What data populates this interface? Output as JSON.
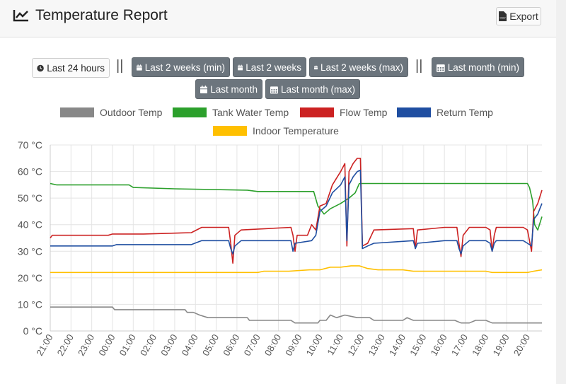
{
  "header": {
    "title": "Temperature Report",
    "export_label": "Export",
    "export_icon": "csv-file-icon"
  },
  "range_buttons": {
    "last_24h": "Last 24 hours",
    "separator": "||",
    "last_2w_min": "Last 2 weeks (min)",
    "last_2w": "Last 2 weeks",
    "last_2w_max": "Last 2 weeks (max)",
    "last_month_min": "Last month (min)",
    "last_month": "Last month",
    "last_month_max": "Last month (max)"
  },
  "chart_data": {
    "type": "line",
    "x_label_times": [
      "21:00",
      "22:00",
      "23:00",
      "00:00",
      "01:00",
      "02:00",
      "03:00",
      "04:00",
      "05:00",
      "06:00",
      "07:00",
      "08:00",
      "09:00",
      "10:00",
      "11:00",
      "12:00",
      "13:00",
      "14:00",
      "15:00",
      "16:00",
      "17:00",
      "18:00",
      "19:00",
      "20:00"
    ],
    "x_range_hours": [
      0,
      23.7
    ],
    "y_ticks": [
      "0 °C",
      "10 °C",
      "20 °C",
      "30 °C",
      "40 °C",
      "50 °C",
      "60 °C",
      "70 °C"
    ],
    "ylim": [
      0,
      70
    ],
    "grid": true,
    "legend_position": "top",
    "series": [
      {
        "name": "Outdoor Temp",
        "color": "#888888",
        "points": [
          [
            0,
            9
          ],
          [
            3.0,
            9
          ],
          [
            3.1,
            8
          ],
          [
            6.5,
            8
          ],
          [
            6.6,
            7
          ],
          [
            6.9,
            7
          ],
          [
            7.2,
            6
          ],
          [
            7.6,
            5
          ],
          [
            8.4,
            5
          ],
          [
            9.5,
            5
          ],
          [
            9.6,
            4
          ],
          [
            11.6,
            4
          ],
          [
            11.8,
            3
          ],
          [
            12.9,
            3
          ],
          [
            13.0,
            4
          ],
          [
            13.3,
            4
          ],
          [
            13.5,
            6
          ],
          [
            13.8,
            5
          ],
          [
            14.2,
            6
          ],
          [
            14.8,
            5
          ],
          [
            15.4,
            5
          ],
          [
            15.6,
            4
          ],
          [
            16.5,
            4
          ],
          [
            17.0,
            4
          ],
          [
            17.2,
            5
          ],
          [
            17.5,
            4
          ],
          [
            18.0,
            4
          ],
          [
            18.5,
            4
          ],
          [
            19.5,
            4
          ],
          [
            19.8,
            3
          ],
          [
            20.2,
            3
          ],
          [
            20.5,
            4
          ],
          [
            21.0,
            4
          ],
          [
            21.3,
            3
          ],
          [
            22.0,
            3
          ],
          [
            23.7,
            3
          ]
        ]
      },
      {
        "name": "Tank Water Temp",
        "color": "#2ca02c",
        "points": [
          [
            0,
            55.5
          ],
          [
            0.3,
            55
          ],
          [
            3.8,
            55
          ],
          [
            4.0,
            54
          ],
          [
            6.0,
            53.5
          ],
          [
            9.5,
            53
          ],
          [
            10.0,
            52.5
          ],
          [
            12.5,
            52.5
          ],
          [
            12.7,
            52.5
          ],
          [
            12.9,
            47
          ],
          [
            13.2,
            44
          ],
          [
            13.5,
            46
          ],
          [
            14.0,
            48
          ],
          [
            14.4,
            50
          ],
          [
            14.7,
            52
          ],
          [
            14.9,
            55.5
          ],
          [
            23.0,
            55.5
          ],
          [
            23.1,
            54
          ],
          [
            23.25,
            49
          ],
          [
            23.35,
            40
          ],
          [
            23.5,
            38
          ],
          [
            23.7,
            43
          ]
        ]
      },
      {
        "name": "Flow Temp",
        "color": "#cc2222",
        "points": [
          [
            0,
            35
          ],
          [
            0.1,
            36
          ],
          [
            2.8,
            36
          ],
          [
            3.0,
            36.5
          ],
          [
            4.5,
            36.5
          ],
          [
            6.8,
            37
          ],
          [
            7.3,
            39
          ],
          [
            8.6,
            39
          ],
          [
            8.7,
            33
          ],
          [
            8.8,
            25.5
          ],
          [
            8.9,
            36
          ],
          [
            9.2,
            38
          ],
          [
            11.6,
            39
          ],
          [
            11.7,
            36
          ],
          [
            11.8,
            30
          ],
          [
            11.9,
            36
          ],
          [
            12.4,
            36
          ],
          [
            12.6,
            40
          ],
          [
            12.8,
            38
          ],
          [
            13.0,
            47
          ],
          [
            13.3,
            48
          ],
          [
            13.6,
            55
          ],
          [
            14.0,
            60
          ],
          [
            14.2,
            63
          ],
          [
            14.3,
            32
          ],
          [
            14.4,
            60
          ],
          [
            14.6,
            63
          ],
          [
            14.8,
            65
          ],
          [
            14.95,
            65
          ],
          [
            15.05,
            32
          ],
          [
            15.3,
            33
          ],
          [
            15.6,
            38
          ],
          [
            17.5,
            38.5
          ],
          [
            17.6,
            31
          ],
          [
            17.7,
            38
          ],
          [
            19.0,
            39
          ],
          [
            19.6,
            39
          ],
          [
            19.7,
            33
          ],
          [
            19.8,
            28
          ],
          [
            19.9,
            36
          ],
          [
            20.2,
            39
          ],
          [
            21.0,
            39
          ],
          [
            21.2,
            38
          ],
          [
            21.3,
            30
          ],
          [
            21.4,
            36
          ],
          [
            21.5,
            39
          ],
          [
            22.8,
            39
          ],
          [
            23.0,
            38
          ],
          [
            23.2,
            30
          ],
          [
            23.3,
            45
          ],
          [
            23.5,
            48
          ],
          [
            23.7,
            53
          ]
        ]
      },
      {
        "name": "Return Temp",
        "color": "#1f4ea1",
        "points": [
          [
            0,
            32
          ],
          [
            3.0,
            32
          ],
          [
            3.2,
            32.5
          ],
          [
            6.8,
            32.5
          ],
          [
            7.3,
            34
          ],
          [
            8.6,
            34
          ],
          [
            8.7,
            31
          ],
          [
            8.8,
            29
          ],
          [
            8.9,
            32
          ],
          [
            9.2,
            34
          ],
          [
            11.6,
            34
          ],
          [
            11.7,
            30
          ],
          [
            11.8,
            33
          ],
          [
            12.6,
            34
          ],
          [
            12.8,
            36
          ],
          [
            13.0,
            45
          ],
          [
            13.3,
            47
          ],
          [
            13.6,
            52
          ],
          [
            14.0,
            55
          ],
          [
            14.2,
            58
          ],
          [
            14.3,
            34
          ],
          [
            14.4,
            55
          ],
          [
            14.6,
            58
          ],
          [
            14.8,
            60
          ],
          [
            14.95,
            60.5
          ],
          [
            15.05,
            31
          ],
          [
            15.3,
            32
          ],
          [
            15.6,
            33
          ],
          [
            17.5,
            34
          ],
          [
            17.6,
            31
          ],
          [
            17.7,
            33
          ],
          [
            19.0,
            34
          ],
          [
            19.6,
            34
          ],
          [
            19.7,
            31
          ],
          [
            19.8,
            29
          ],
          [
            19.9,
            32
          ],
          [
            20.2,
            34
          ],
          [
            21.0,
            34
          ],
          [
            21.2,
            33
          ],
          [
            21.3,
            30
          ],
          [
            21.4,
            33
          ],
          [
            21.5,
            34
          ],
          [
            22.8,
            34
          ],
          [
            23.0,
            33
          ],
          [
            23.2,
            32
          ],
          [
            23.3,
            42
          ],
          [
            23.5,
            44
          ],
          [
            23.7,
            48
          ]
        ]
      },
      {
        "name": "Indoor Temperature",
        "color": "#ffc000",
        "points": [
          [
            0,
            22
          ],
          [
            10.0,
            22
          ],
          [
            10.3,
            22.5
          ],
          [
            11.5,
            22.5
          ],
          [
            12.5,
            23
          ],
          [
            13.0,
            23
          ],
          [
            13.5,
            24
          ],
          [
            14.0,
            24
          ],
          [
            14.5,
            24.5
          ],
          [
            14.9,
            24.5
          ],
          [
            15.3,
            23.5
          ],
          [
            15.8,
            23
          ],
          [
            17.0,
            23
          ],
          [
            17.5,
            22.5
          ],
          [
            19.0,
            22.5
          ],
          [
            20.0,
            22.5
          ],
          [
            21.0,
            22.5
          ],
          [
            21.3,
            22
          ],
          [
            23.0,
            22
          ],
          [
            23.3,
            22.5
          ],
          [
            23.7,
            23
          ]
        ]
      }
    ]
  }
}
